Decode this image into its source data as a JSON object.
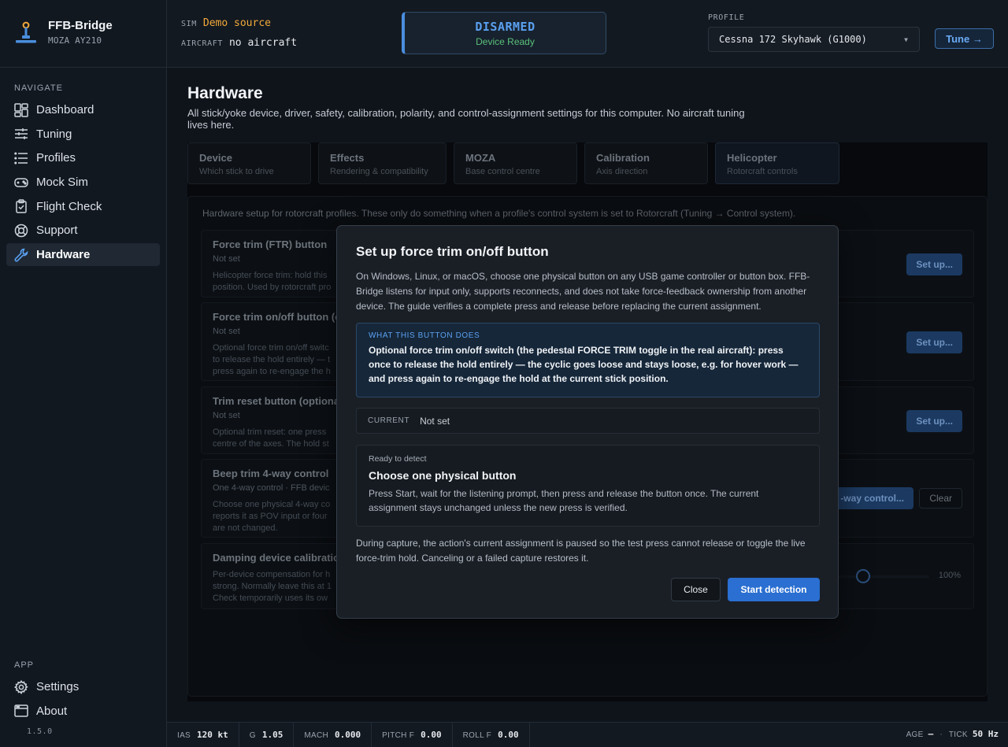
{
  "app": {
    "title": "FFB-Bridge",
    "device": "MOZA AY210",
    "version": "1.5.0"
  },
  "sidebar": {
    "navigate_heading": "NAVIGATE",
    "nav": [
      {
        "label": "Dashboard",
        "icon": "dashboard-icon"
      },
      {
        "label": "Tuning",
        "icon": "sliders-icon"
      },
      {
        "label": "Profiles",
        "icon": "list-icon"
      },
      {
        "label": "Mock Sim",
        "icon": "gamepad-icon"
      },
      {
        "label": "Flight Check",
        "icon": "clipboard-check-icon"
      },
      {
        "label": "Support",
        "icon": "lifebuoy-icon"
      },
      {
        "label": "Hardware",
        "icon": "wrench-icon",
        "active": true
      }
    ],
    "app_heading": "APP",
    "app_nav": [
      {
        "label": "Settings",
        "icon": "gear-icon"
      },
      {
        "label": "About",
        "icon": "window-icon"
      }
    ]
  },
  "topbar": {
    "sim_key": "SIM",
    "sim_value": "Demo source",
    "aircraft_key": "AIRCRAFT",
    "aircraft_value": "no aircraft",
    "arm_state": "DISARMED",
    "arm_sub": "Device Ready",
    "profile_label": "PROFILE",
    "profile_value": "Cessna 172 Skyhawk (G1000)",
    "tune_label": "Tune →",
    "colors": {
      "sim": "#f2a93b",
      "armed_blue": "#5aa0f0",
      "ready_green": "#5cc07a"
    }
  },
  "page": {
    "title": "Hardware",
    "description": "All stick/yoke device, driver, safety, calibration, polarity, and control-assignment settings for this computer. No aircraft tuning lives here.",
    "tabs": [
      {
        "title": "Device",
        "sub": "Which stick to drive"
      },
      {
        "title": "Effects",
        "sub": "Rendering & compatibility"
      },
      {
        "title": "MOZA",
        "sub": "Base control centre"
      },
      {
        "title": "Calibration",
        "sub": "Axis direction"
      },
      {
        "title": "Helicopter",
        "sub": "Rotorcraft controls",
        "active": true
      }
    ],
    "intro": "Hardware setup for rotorcraft profiles. These only do something when a profile's control system is set to Rotorcraft (Tuning → Control system).",
    "cards": [
      {
        "title": "Force trim (FTR) button",
        "status": "Not set",
        "desc": [
          "Helicopter force trim: hold this",
          "position. Used by rotorcraft pro"
        ],
        "button": "Set up..."
      },
      {
        "title": "Force trim on/off button (o",
        "status": "Not set",
        "desc": [
          "Optional force trim on/off switc",
          "to release the hold entirely — t",
          "press again to re-engage the h"
        ],
        "button": "Set up..."
      },
      {
        "title": "Trim reset button (optiona",
        "status": "Not set",
        "desc": [
          "Optional trim reset: one press",
          "centre of the axes. The hold st"
        ],
        "button": "Set up..."
      },
      {
        "title": "Beep trim 4-way control",
        "status": "One 4-way control · FFB devic",
        "desc": [
          "Choose one physical 4-way co",
          "reports it as POV input or four",
          "are not changed."
        ],
        "button": "-way control...",
        "clear": "Clear"
      },
      {
        "title": "Damping device calibratio",
        "desc": [
          "Per-device compensation for h",
          "strong. Normally leave this at 1",
          "Check temporarily uses its ow"
        ],
        "value": "100%"
      }
    ]
  },
  "modal": {
    "title": "Set up force trim on/off button",
    "intro": "On Windows, Linux, or macOS, choose one physical button on any USB game controller or button box. FFB-Bridge listens for input only, supports reconnects, and does not take force-feedback ownership from another device. The guide verifies a complete press and release before replacing the current assignment.",
    "what_label": "WHAT THIS BUTTON DOES",
    "what_text": "Optional force trim on/off switch (the pedestal FORCE TRIM toggle in the real aircraft): press once to release the hold entirely — the cyclic goes loose and stays loose, e.g. for hover work — and press again to re-engage the hold at the current stick position.",
    "current_key": "CURRENT",
    "current_value": "Not set",
    "detect_label": "Ready to detect",
    "detect_title": "Choose one physical button",
    "detect_text": "Press Start, wait for the listening prompt, then press and release the button once. The current assignment stays unchanged unless the new press is verified.",
    "note": "During capture, the action's current assignment is paused so the test press cannot release or toggle the live force-trim hold. Canceling or a failed capture restores it.",
    "close_label": "Close",
    "start_label": "Start detection"
  },
  "statusbar": {
    "items": [
      {
        "k": "IAS",
        "v": "120 kt"
      },
      {
        "k": "G",
        "v": "1.05"
      },
      {
        "k": "MACH",
        "v": "0.000"
      },
      {
        "k": "PITCH F",
        "v": "0.00"
      },
      {
        "k": "ROLL F",
        "v": "0.00"
      }
    ],
    "age_key": "AGE",
    "age_value": "—",
    "separator": "·",
    "tick_key": "TICK",
    "tick_value": "50 Hz"
  }
}
